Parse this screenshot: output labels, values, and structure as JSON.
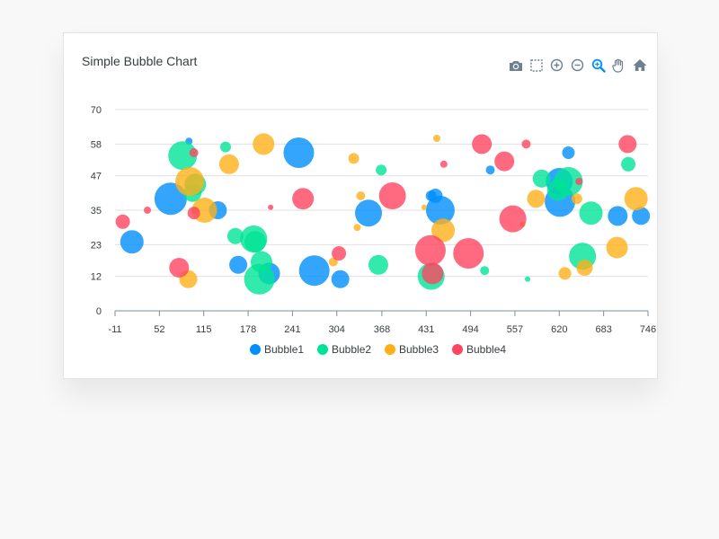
{
  "chart_data": {
    "type": "scatter",
    "title": "Simple Bubble Chart",
    "xlabel": "",
    "ylabel": "",
    "x_ticks": [
      "-11",
      "52",
      "115",
      "178",
      "241",
      "304",
      "368",
      "431",
      "494",
      "557",
      "620",
      "683",
      "746"
    ],
    "y_ticks": [
      "0",
      "12",
      "23",
      "35",
      "47",
      "58",
      "70"
    ],
    "xlim": [
      -11,
      746
    ],
    "ylim": [
      0,
      70
    ],
    "grid": "horizontal",
    "legend_position": "bottom",
    "series": [
      {
        "name": "Bubble1",
        "color": "#008FFB",
        "points": [
          {
            "x": 13,
            "y": 24,
            "size": 13
          },
          {
            "x": 68,
            "y": 39,
            "size": 18
          },
          {
            "x": 94,
            "y": 59,
            "size": 4
          },
          {
            "x": 103,
            "y": 35,
            "size": 4
          },
          {
            "x": 135,
            "y": 35,
            "size": 10
          },
          {
            "x": 164,
            "y": 16,
            "size": 10
          },
          {
            "x": 208,
            "y": 13,
            "size": 12
          },
          {
            "x": 250,
            "y": 55,
            "size": 17
          },
          {
            "x": 272,
            "y": 14,
            "size": 17
          },
          {
            "x": 309,
            "y": 11,
            "size": 10
          },
          {
            "x": 349,
            "y": 34,
            "size": 15
          },
          {
            "x": 438,
            "y": 40,
            "size": 6
          },
          {
            "x": 444,
            "y": 40,
            "size": 8
          },
          {
            "x": 451,
            "y": 35,
            "size": 16
          },
          {
            "x": 522,
            "y": 49,
            "size": 5
          },
          {
            "x": 620,
            "y": 45,
            "size": 15
          },
          {
            "x": 621,
            "y": 38,
            "size": 17
          },
          {
            "x": 633,
            "y": 55,
            "size": 7
          },
          {
            "x": 703,
            "y": 33,
            "size": 11
          },
          {
            "x": 736,
            "y": 33,
            "size": 10
          }
        ]
      },
      {
        "name": "Bubble2",
        "color": "#00E396",
        "points": [
          {
            "x": 85,
            "y": 54,
            "size": 16
          },
          {
            "x": 99,
            "y": 41,
            "size": 10
          },
          {
            "x": 103,
            "y": 44,
            "size": 12
          },
          {
            "x": 146,
            "y": 57,
            "size": 6
          },
          {
            "x": 160,
            "y": 26,
            "size": 9
          },
          {
            "x": 186,
            "y": 25,
            "size": 15
          },
          {
            "x": 188,
            "y": 24,
            "size": 12
          },
          {
            "x": 197,
            "y": 17,
            "size": 12
          },
          {
            "x": 194,
            "y": 11,
            "size": 17
          },
          {
            "x": 363,
            "y": 16,
            "size": 11
          },
          {
            "x": 367,
            "y": 49,
            "size": 6
          },
          {
            "x": 438,
            "y": 12,
            "size": 15
          },
          {
            "x": 514,
            "y": 14,
            "size": 5
          },
          {
            "x": 575,
            "y": 11,
            "size": 3
          },
          {
            "x": 595,
            "y": 46,
            "size": 10
          },
          {
            "x": 618,
            "y": 42,
            "size": 12
          },
          {
            "x": 633,
            "y": 45,
            "size": 16
          },
          {
            "x": 653,
            "y": 19,
            "size": 15
          },
          {
            "x": 665,
            "y": 34,
            "size": 13
          },
          {
            "x": 718,
            "y": 51,
            "size": 8
          }
        ]
      },
      {
        "name": "Bubble3",
        "color": "#FEB019",
        "points": [
          {
            "x": 93,
            "y": 11,
            "size": 10
          },
          {
            "x": 95,
            "y": 45,
            "size": 16
          },
          {
            "x": 116,
            "y": 35,
            "size": 14
          },
          {
            "x": 151,
            "y": 51,
            "size": 11
          },
          {
            "x": 200,
            "y": 58,
            "size": 12
          },
          {
            "x": 299,
            "y": 17,
            "size": 5
          },
          {
            "x": 328,
            "y": 53,
            "size": 6
          },
          {
            "x": 338,
            "y": 40,
            "size": 5
          },
          {
            "x": 333,
            "y": 29,
            "size": 4
          },
          {
            "x": 428,
            "y": 36,
            "size": 3
          },
          {
            "x": 446,
            "y": 60,
            "size": 4
          },
          {
            "x": 455,
            "y": 28,
            "size": 13
          },
          {
            "x": 568,
            "y": 30,
            "size": 3
          },
          {
            "x": 587,
            "y": 39,
            "size": 10
          },
          {
            "x": 628,
            "y": 13,
            "size": 7
          },
          {
            "x": 645,
            "y": 39,
            "size": 6
          },
          {
            "x": 656,
            "y": 15,
            "size": 9
          },
          {
            "x": 702,
            "y": 22,
            "size": 12
          },
          {
            "x": 729,
            "y": 39,
            "size": 13
          }
        ]
      },
      {
        "name": "Bubble4",
        "color": "#FF4560",
        "points": [
          {
            "x": 0,
            "y": 31,
            "size": 8
          },
          {
            "x": 35,
            "y": 35,
            "size": 4
          },
          {
            "x": 80,
            "y": 15,
            "size": 11
          },
          {
            "x": 101,
            "y": 34,
            "size": 7
          },
          {
            "x": 101,
            "y": 55,
            "size": 5
          },
          {
            "x": 210,
            "y": 36,
            "size": 3
          },
          {
            "x": 256,
            "y": 39,
            "size": 12
          },
          {
            "x": 307,
            "y": 20,
            "size": 8
          },
          {
            "x": 383,
            "y": 40,
            "size": 15
          },
          {
            "x": 440,
            "y": 13,
            "size": 12
          },
          {
            "x": 437,
            "y": 21,
            "size": 17
          },
          {
            "x": 456,
            "y": 51,
            "size": 4
          },
          {
            "x": 491,
            "y": 20,
            "size": 17
          },
          {
            "x": 510,
            "y": 58,
            "size": 11
          },
          {
            "x": 542,
            "y": 52,
            "size": 11
          },
          {
            "x": 554,
            "y": 32,
            "size": 15
          },
          {
            "x": 573,
            "y": 58,
            "size": 5
          },
          {
            "x": 648,
            "y": 45,
            "size": 4
          },
          {
            "x": 717,
            "y": 58,
            "size": 10
          }
        ]
      }
    ]
  },
  "toolbar": [
    {
      "name": "camera-icon"
    },
    {
      "name": "selection-icon"
    },
    {
      "name": "zoom-in-icon"
    },
    {
      "name": "zoom-out-icon"
    },
    {
      "name": "zoom-icon"
    },
    {
      "name": "pan-icon"
    },
    {
      "name": "home-icon"
    }
  ]
}
